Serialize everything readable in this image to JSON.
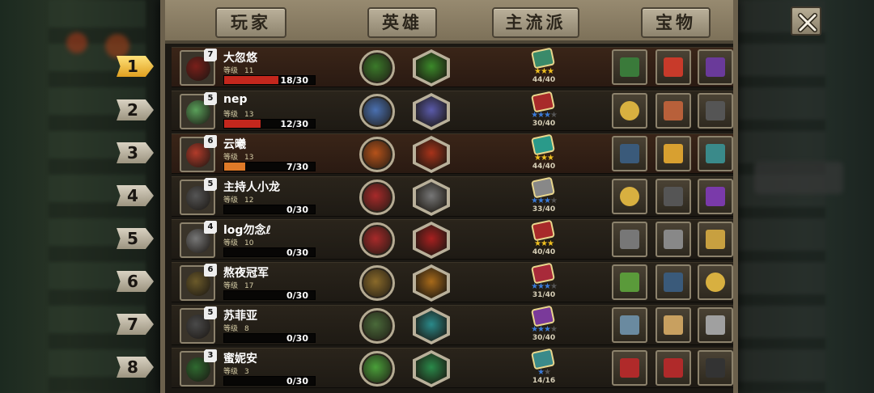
{
  "tabs": [
    "玩家",
    "英雄",
    "主流派",
    "宝物"
  ],
  "players": [
    {
      "rank": "1",
      "name": "大忽悠",
      "level_label": "等级",
      "level": "11",
      "hero_level": "7",
      "progress_text": "18/30",
      "progress": 0.6,
      "stars_filled": 3,
      "stars_total": 3,
      "faction_count": "44/40",
      "highlight": true
    },
    {
      "rank": "2",
      "name": "nep",
      "level_label": "等级",
      "level": "13",
      "hero_level": "5",
      "progress_text": "12/30",
      "progress": 0.4,
      "stars_filled": 3,
      "stars_total": 4,
      "faction_count": "30/40",
      "highlight": false
    },
    {
      "rank": "3",
      "name": "云曦",
      "level_label": "等级",
      "level": "13",
      "hero_level": "6",
      "progress_text": "7/30",
      "progress": 0.23,
      "stars_filled": 3,
      "stars_total": 3,
      "faction_count": "44/40",
      "highlight": true
    },
    {
      "rank": "4",
      "name": "主持人小龙",
      "level_label": "等级",
      "level": "12",
      "hero_level": "5",
      "progress_text": "0/30",
      "progress": 0,
      "stars_filled": 3,
      "stars_total": 4,
      "faction_count": "33/40",
      "highlight": false
    },
    {
      "rank": "5",
      "name": "log勿念ℓ",
      "level_label": "等级",
      "level": "10",
      "hero_level": "4",
      "progress_text": "0/30",
      "progress": 0,
      "stars_filled": 3,
      "stars_total": 3,
      "faction_count": "40/40",
      "highlight": false
    },
    {
      "rank": "6",
      "name": "熬夜冠军",
      "level_label": "等级",
      "level": "17",
      "hero_level": "6",
      "progress_text": "0/30",
      "progress": 0,
      "stars_filled": 3,
      "stars_total": 4,
      "faction_count": "31/40",
      "highlight": false
    },
    {
      "rank": "7",
      "name": "苏菲亚",
      "level_label": "等级",
      "level": "8",
      "hero_level": "5",
      "progress_text": "0/30",
      "progress": 0,
      "stars_filled": 3,
      "stars_total": 4,
      "faction_count": "30/40",
      "highlight": false
    },
    {
      "rank": "8",
      "name": "蜜妮安",
      "level_label": "等级",
      "level": "3",
      "hero_level": "3",
      "progress_text": "0/30",
      "progress": 0,
      "stars_filled": 1,
      "stars_total": 2,
      "faction_count": "14/16",
      "highlight": false
    }
  ],
  "colors": {
    "avatars": [
      "#7a1f1a",
      "#5aa05a",
      "#b23b2a",
      "#555555",
      "#777777",
      "#6b5a2a",
      "#4a4a4a",
      "#2f6a30"
    ],
    "traits": [
      "#3b7a2a",
      "#4a70b0",
      "#b5521a",
      "#a82a2a",
      "#a82a2a",
      "#8a6a2a",
      "#4a6a3a",
      "#4aa03a"
    ],
    "classes": [
      "#3b8a2a",
      "#5a5aaa",
      "#a8331a",
      "#777777",
      "#a82020",
      "#a86a1a",
      "#2a8a8a",
      "#2a8a4a"
    ],
    "factions": [
      "#3a8a6a",
      "#a82a2a",
      "#2a9a8a",
      "#888888",
      "#a82a2a",
      "#a82a3a",
      "#7a3a9a",
      "#3a8a8a"
    ]
  },
  "items": [
    [
      "book-icon",
      "gem-icon",
      "spellbook-icon"
    ],
    [
      "watch-icon",
      "chest-icon",
      "scroll-icon"
    ],
    [
      "tome-icon",
      "staff-icon",
      "cloth-icon"
    ],
    [
      "coin-icon",
      "card-icon",
      "potion-icon"
    ],
    [
      "box-icon",
      "shell-icon",
      "scales-icon"
    ],
    [
      "cash-icon",
      "tome-icon",
      "coin-icon"
    ],
    [
      "armor-icon",
      "clipboard-icon",
      "sword-icon"
    ],
    [
      "red-book-icon",
      "red-book-icon",
      "spider-icon"
    ]
  ],
  "item_colors": [
    [
      "#3a7a3a",
      "#c83a2a",
      "#6a3a9a"
    ],
    [
      "#d8b040",
      "#b8603a",
      "#555555"
    ],
    [
      "#3a5a7a",
      "#d8a030",
      "#3a8a8a"
    ],
    [
      "#d8b040",
      "#555555",
      "#7a3aaa"
    ],
    [
      "#777777",
      "#888888",
      "#c8a040"
    ],
    [
      "#5a9a3a",
      "#3a5a7a",
      "#d8b040"
    ],
    [
      "#6a8aa0",
      "#c8a060",
      "#a0a0a0"
    ],
    [
      "#b02a2a",
      "#b02a2a",
      "#333333"
    ]
  ]
}
